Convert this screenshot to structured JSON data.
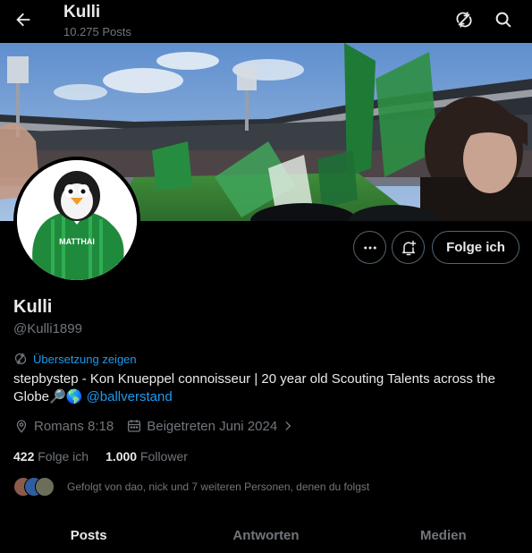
{
  "header": {
    "title": "Kulli",
    "posts_count": "10.275 Posts",
    "icons": [
      "back-arrow-icon",
      "refresh-slash-icon",
      "search-icon"
    ]
  },
  "profile": {
    "name": "Kulli",
    "handle": "@Kulli1899",
    "translate_label": "Übersetzung zeigen",
    "bio_text": "stepbystep - Kon Knueppel connoisseur | 20 year old Scouting Talents across the Globe🔎🌎 ",
    "bio_link": "@ballverstand",
    "location": "Romans 8:18",
    "joined": "Beigetreten Juni 2024",
    "following_count": "422",
    "following_label": "Folge ich",
    "followers_count": "1.000",
    "followers_label": "Follower",
    "followed_by": "Gefolgt von dao, nick und 7 weiteren Personen, denen du folgst",
    "avatar_jersey_text": "MATTHAI"
  },
  "actions": {
    "follow_button": "Folge ich",
    "icons": [
      "more-icon",
      "notification-bell-plus-icon"
    ]
  },
  "tabs": [
    {
      "label": "Posts",
      "active": true
    },
    {
      "label": "Antworten",
      "active": false
    },
    {
      "label": "Medien",
      "active": false
    }
  ],
  "colors": {
    "background": "#000000",
    "text": "#e7e9ea",
    "secondary": "#71767b",
    "accent": "#1d9bf0",
    "border": "#536471",
    "jersey_green": "#1f8a3c"
  }
}
